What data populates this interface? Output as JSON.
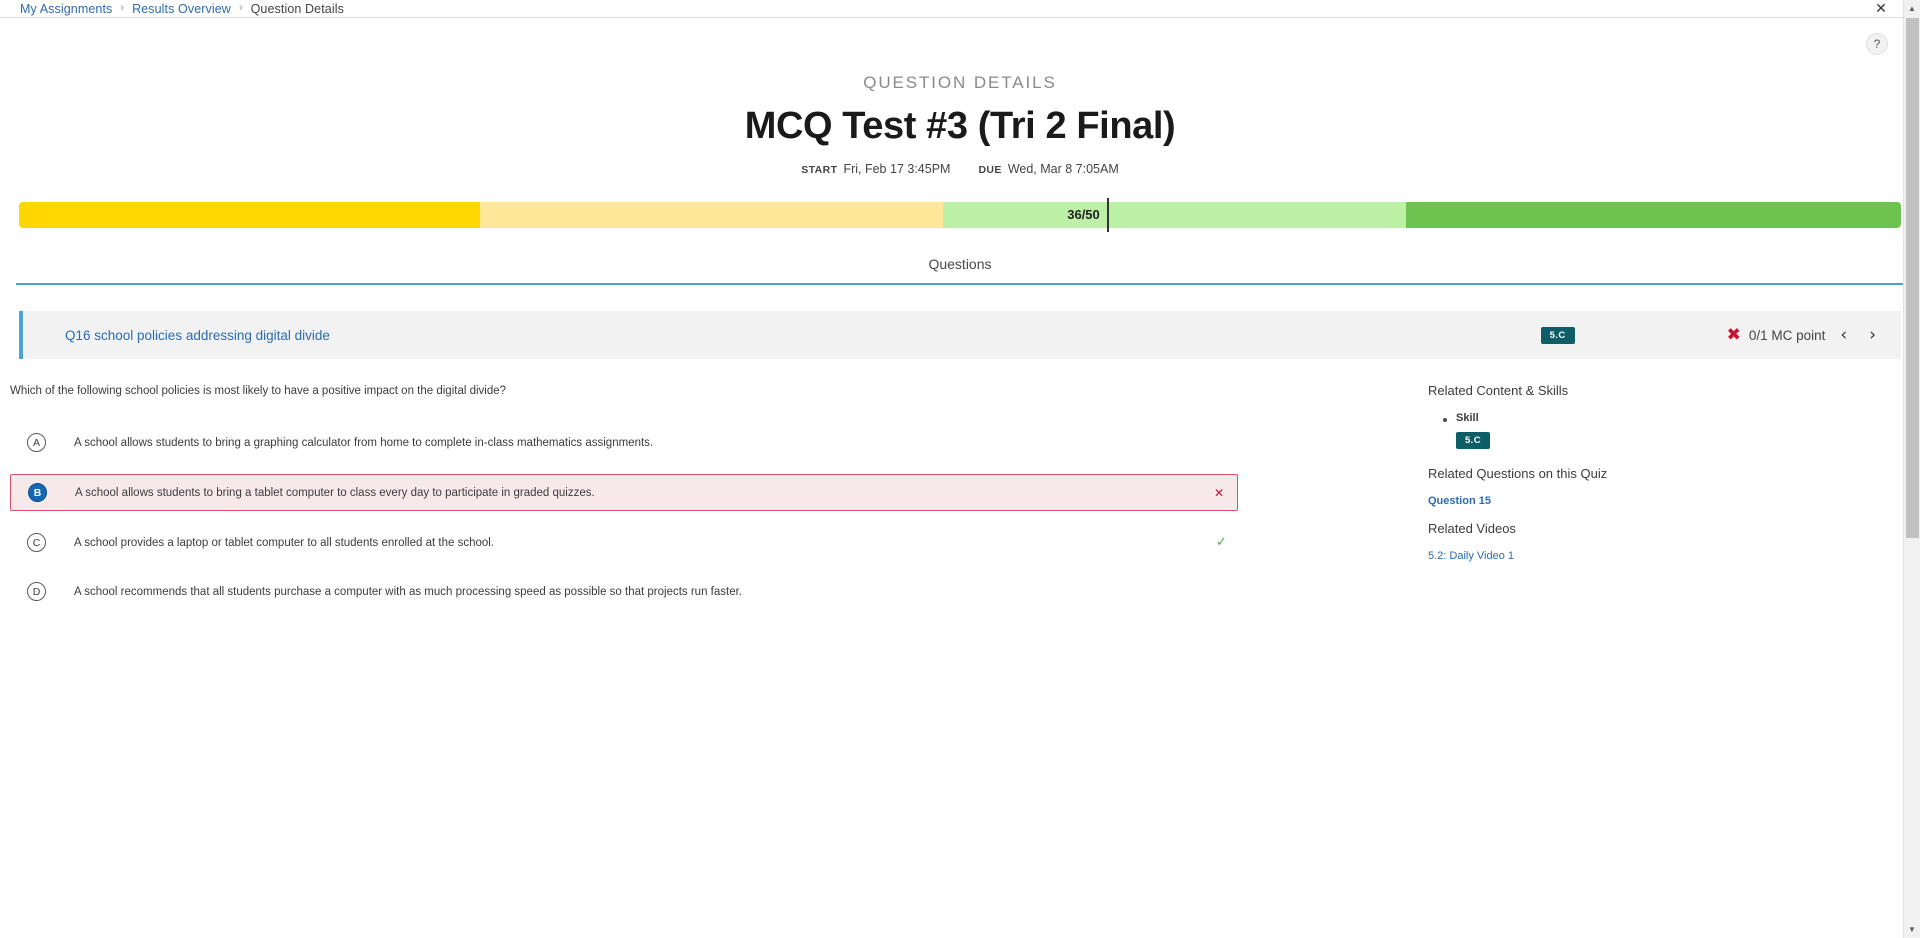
{
  "breadcrumb": {
    "items": [
      {
        "label": "My Assignments",
        "current": false
      },
      {
        "label": "Results Overview",
        "current": false
      },
      {
        "label": "Question Details",
        "current": true
      }
    ],
    "separator": "›"
  },
  "window": {
    "close_label": "✕",
    "help_label": "?",
    "scroll_up": "▲",
    "scroll_down": "▼"
  },
  "header": {
    "eyebrow": "QUESTION DETAILS",
    "title": "MCQ Test #3 (Tri 2 Final)",
    "start_label": "START",
    "start_value": "Fri, Feb 17 3:45PM",
    "due_label": "DUE",
    "due_value": "Wed, Mar 8 7:05AM"
  },
  "score_bar": {
    "score_text": "36/50",
    "score_earned": 36,
    "score_total": 50,
    "marker_percent": 57.8,
    "segments": [
      {
        "name": "low",
        "color": "#ffd700",
        "percent": 24.5
      },
      {
        "name": "mid-low",
        "color": "#ffe79a",
        "percent": 24.6
      },
      {
        "name": "mid-high",
        "color": "#bbf0a6",
        "percent": 24.6
      },
      {
        "name": "high",
        "color": "#6dc350",
        "percent": 26.3
      }
    ]
  },
  "tabs": [
    {
      "label": "Questions",
      "active": true
    }
  ],
  "question_strip": {
    "link_label": "Q16 school policies addressing digital divide",
    "skill_badge": "5.C",
    "result_icon": "x-mark-icon",
    "points": "0/1 MC point",
    "prev_arrow": "‹",
    "next_arrow": "›"
  },
  "question": {
    "stem": "Which of the following school policies is most likely to have a positive impact on the digital divide?",
    "choices": [
      {
        "letter": "A",
        "text": "A school allows students to bring a graphing calculator from home to complete in-class mathematics assignments.",
        "selected": false,
        "correct": false,
        "mark": ""
      },
      {
        "letter": "B",
        "text": "A school allows students to bring a tablet computer to class every day to participate in graded quizzes.",
        "selected": true,
        "correct": false,
        "mark": "✕"
      },
      {
        "letter": "C",
        "text": "A school provides a laptop or tablet computer to all students enrolled at the school.",
        "selected": false,
        "correct": true,
        "mark": "✓"
      },
      {
        "letter": "D",
        "text": "A school recommends that all students purchase a computer with as much processing speed as possible so that projects run faster.",
        "selected": false,
        "correct": false,
        "mark": ""
      }
    ]
  },
  "sidebar": {
    "related_content_heading": "Related Content & Skills",
    "skill_label": "Skill",
    "skill_badge": "5.C",
    "related_questions_heading": "Related Questions on this Quiz",
    "related_questions": [
      {
        "label": "Question 15"
      }
    ],
    "related_videos_heading": "Related Videos",
    "related_videos": [
      {
        "label": "5.2: Daily Video 1"
      }
    ]
  },
  "colors": {
    "link": "#2b6cb0",
    "accent_tab": "#4ba3d3",
    "badge_teal": "#0d5e66",
    "wrong_red": "#c8102e",
    "correct_green": "#52a747",
    "selected_blue": "#1668b3"
  }
}
